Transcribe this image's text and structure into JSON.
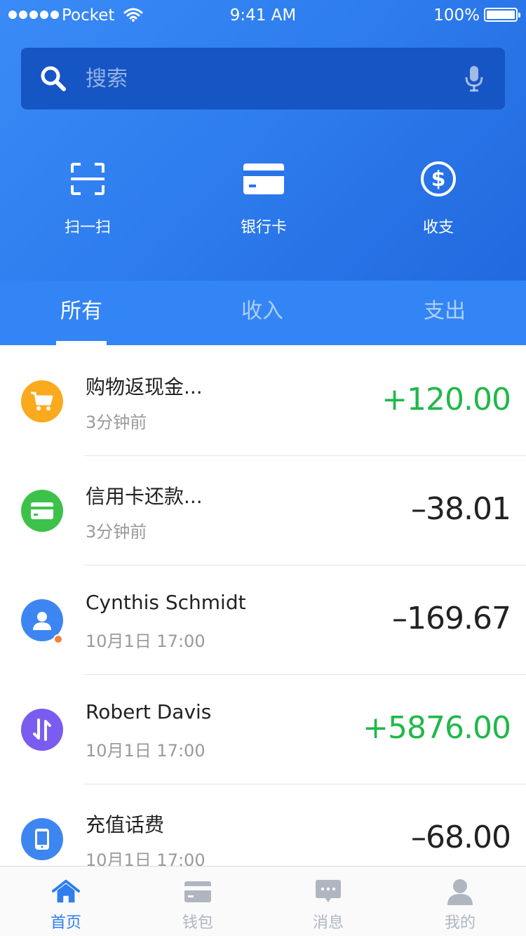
{
  "status_bar": {
    "carrier": "Pocket",
    "time": "9:41 AM",
    "battery": "100%"
  },
  "search": {
    "placeholder": "搜索"
  },
  "quick_actions": [
    {
      "label": "扫一扫",
      "icon": "scan-icon"
    },
    {
      "label": "银行卡",
      "icon": "bank-card-icon"
    },
    {
      "label": "收支",
      "icon": "dollar-icon"
    }
  ],
  "tabs": [
    {
      "label": "所有",
      "active": true
    },
    {
      "label": "收入",
      "active": false
    },
    {
      "label": "支出",
      "active": false
    }
  ],
  "transactions": [
    {
      "title": "购物返现金...",
      "time": "3分钟前",
      "amount": "+120.00",
      "type": "income",
      "icon": "cart-icon",
      "color": "#fbaa1e"
    },
    {
      "title": "信用卡还款...",
      "time": "3分钟前",
      "amount": "–38.01",
      "type": "expense",
      "icon": "card-icon",
      "color": "#3cc24b"
    },
    {
      "title": "Cynthis Schmidt",
      "time": "10月1日   17:00",
      "amount": "–169.67",
      "type": "expense",
      "icon": "person-icon",
      "color": "#3d86f2"
    },
    {
      "title": "Robert Davis",
      "time": "10月1日   17:00",
      "amount": "+5876.00",
      "type": "income",
      "icon": "transfer-icon",
      "color": "#7b5cf0"
    },
    {
      "title": "充值话费",
      "time": "10月1日   17:00",
      "amount": "–68.00",
      "type": "expense",
      "icon": "phone-icon",
      "color": "#3d86f2"
    }
  ],
  "tab_bar": [
    {
      "label": "首页",
      "icon": "home-icon",
      "active": true
    },
    {
      "label": "钱包",
      "icon": "wallet-icon",
      "active": false
    },
    {
      "label": "消息",
      "icon": "message-icon",
      "active": false
    },
    {
      "label": "我的",
      "icon": "profile-icon",
      "active": false
    }
  ],
  "colors": {
    "primary": "#2f7eef",
    "income": "#20b84a",
    "expense": "#222222",
    "badge": "#f5823a"
  }
}
